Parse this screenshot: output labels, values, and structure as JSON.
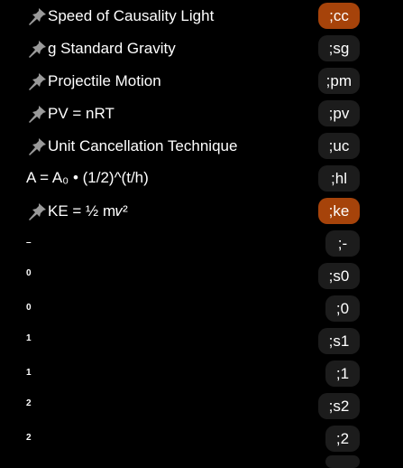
{
  "rows": [
    {
      "pinned": true,
      "label": "Speed of Causality Light",
      "shortcut": ";cc",
      "active": true
    },
    {
      "pinned": true,
      "label": "g Standard Gravity",
      "shortcut": ";sg",
      "active": false
    },
    {
      "pinned": true,
      "label": "Projectile Motion",
      "shortcut": ";pm",
      "active": false
    },
    {
      "pinned": true,
      "label": "PV = nRT",
      "shortcut": ";pv",
      "active": false
    },
    {
      "pinned": true,
      "label": "Unit Cancellation Technique",
      "shortcut": ";uc",
      "active": false
    },
    {
      "pinned": false,
      "label": "A = A₀ • (1/2)^(t/h)",
      "shortcut": ";hl",
      "active": false
    },
    {
      "pinned": true,
      "label": "KE = ½ m𝑣²",
      "shortcut": ";ke",
      "active": true
    },
    {
      "pinned": false,
      "label": "–",
      "small": true,
      "shortcut": ";-",
      "active": false
    },
    {
      "pinned": false,
      "label": "0",
      "small": true,
      "shortcut": ";s0",
      "active": false
    },
    {
      "pinned": false,
      "label": "0",
      "small": true,
      "shortcut": ";0",
      "active": false
    },
    {
      "pinned": false,
      "label": "1",
      "small": true,
      "shortcut": ";s1",
      "active": false
    },
    {
      "pinned": false,
      "label": "1",
      "small": true,
      "shortcut": ";1",
      "active": false
    },
    {
      "pinned": false,
      "label": "2",
      "small": true,
      "shortcut": ";s2",
      "active": false
    },
    {
      "pinned": false,
      "label": "2",
      "small": true,
      "shortcut": ";2",
      "active": false
    }
  ],
  "colors": {
    "background": "#000000",
    "pill": "#1c1c1c",
    "pill_active": "#a6430a",
    "text": "#ffffff",
    "pin_icon": "#9a9a9a"
  },
  "icons": {
    "pin": "pin-icon"
  }
}
